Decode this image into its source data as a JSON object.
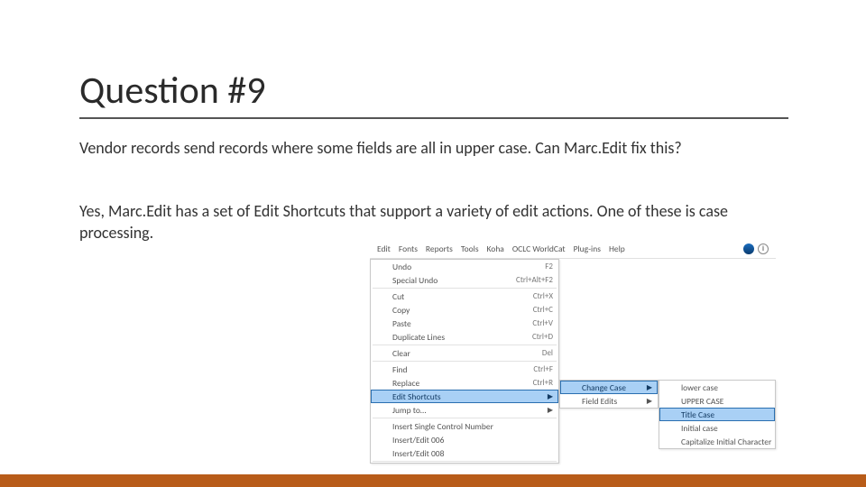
{
  "title": "Question #9",
  "para1": "Vendor records send records where some fields are all in upper case.  Can Marc.Edit fix this?",
  "para2": "Yes, Marc.Edit has a set of Edit Shortcuts that support a variety of edit actions.  One of these is case processing.",
  "screenshot": {
    "menubar": [
      "Edit",
      "Fonts",
      "Reports",
      "Tools",
      "Koha",
      "OCLC WorldCat",
      "Plug-ins",
      "Help"
    ],
    "icons": {
      "globe": "globe-icon",
      "info": "i"
    },
    "edit_menu": [
      {
        "type": "item",
        "label": "Undo",
        "shortcut": "F2"
      },
      {
        "type": "item",
        "label": "Special Undo",
        "shortcut": "Ctrl+Alt+F2"
      },
      {
        "type": "sep"
      },
      {
        "type": "item",
        "label": "Cut",
        "shortcut": "Ctrl+X"
      },
      {
        "type": "item",
        "label": "Copy",
        "shortcut": "Ctrl+C"
      },
      {
        "type": "item",
        "label": "Paste",
        "shortcut": "Ctrl+V"
      },
      {
        "type": "item",
        "label": "Duplicate Lines",
        "shortcut": "Ctrl+D"
      },
      {
        "type": "sep"
      },
      {
        "type": "item",
        "label": "Clear",
        "shortcut": "Del"
      },
      {
        "type": "sep"
      },
      {
        "type": "item",
        "label": "Find",
        "shortcut": "Ctrl+F"
      },
      {
        "type": "item",
        "label": "Replace",
        "shortcut": "Ctrl+R"
      },
      {
        "type": "item",
        "label": "Edit Shortcuts",
        "submenu": true,
        "highlight": true
      },
      {
        "type": "item",
        "label": "Jump to…",
        "submenu": true
      },
      {
        "type": "sep"
      },
      {
        "type": "item",
        "label": "Insert Single Control Number"
      },
      {
        "type": "item",
        "label": "Insert/Edit 006"
      },
      {
        "type": "item",
        "label": "Insert/Edit 008"
      },
      {
        "type": "sep"
      }
    ],
    "submenu1": [
      {
        "label": "Change Case",
        "submenu": true,
        "highlight": true
      },
      {
        "label": "Field Edits",
        "submenu": true
      }
    ],
    "submenu2": [
      {
        "label": "lower case"
      },
      {
        "label": "UPPER CASE"
      },
      {
        "label": "Title Case",
        "highlight": true
      },
      {
        "label": "Initial case"
      },
      {
        "label": "Capitalize Initial Character"
      }
    ]
  }
}
